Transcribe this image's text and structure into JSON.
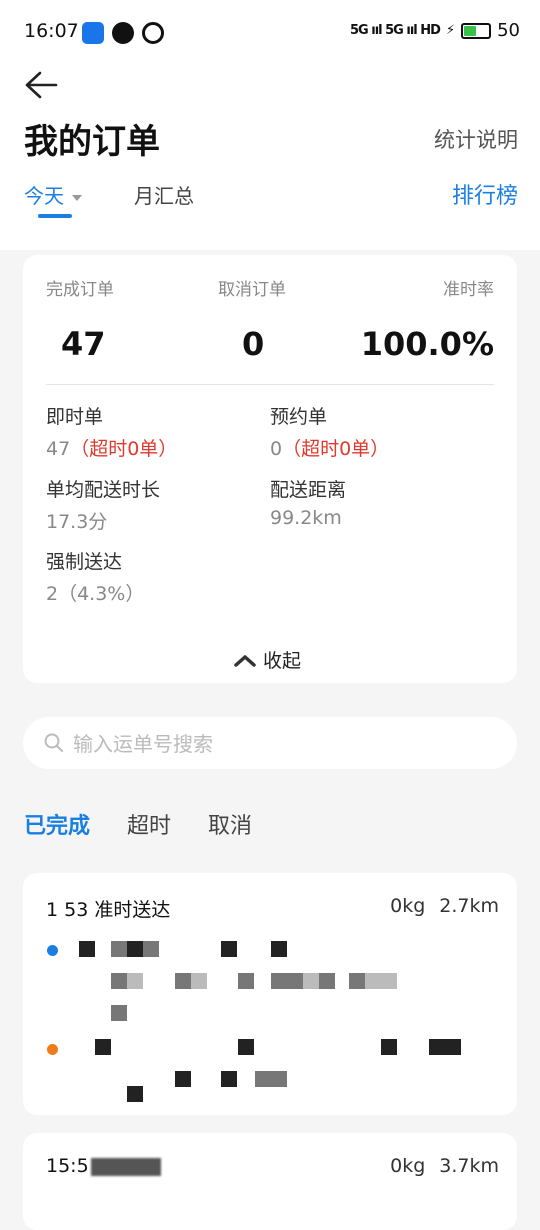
{
  "status_bar": {
    "time": "16:07",
    "network": "5G ııl 5G ııl HD",
    "battery": "50"
  },
  "header": {
    "title": "我的订单",
    "explain_label": "统计说明"
  },
  "tabs": {
    "today": "今天",
    "month": "月汇总",
    "rank": "排行榜"
  },
  "stats": {
    "completed_label": "完成订单",
    "completed_value": "47",
    "canceled_label": "取消订单",
    "canceled_value": "0",
    "ontime_label": "准时率",
    "ontime_value": "100.0%",
    "instant_label": "即时单",
    "instant_value": "47",
    "instant_overtime": "（超时0单）",
    "reserved_label": "预约单",
    "reserved_value": "0",
    "reserved_overtime": "（超时0单）",
    "avg_time_label": "单均配送时长",
    "avg_time_value": "17.3分",
    "distance_label": "配送距离",
    "distance_value": "99.2km",
    "forced_label": "强制送达",
    "forced_value": "2（4.3%）",
    "collapse_label": "收起"
  },
  "search": {
    "placeholder": "输入运单号搜索"
  },
  "filter_tabs": [
    "已完成",
    "超时",
    "取消"
  ],
  "orders": [
    {
      "head": "1 53 准时送达",
      "weight": "0kg",
      "distance": "2.7km"
    },
    {
      "head": "15:5",
      "weight": "0kg",
      "distance": "3.7km"
    }
  ],
  "colors": {
    "accent": "#1b7fe2",
    "warning": "#e03a2e",
    "pickup_dot": "#1b7fe2",
    "dropoff_dot": "#f07b1a"
  }
}
